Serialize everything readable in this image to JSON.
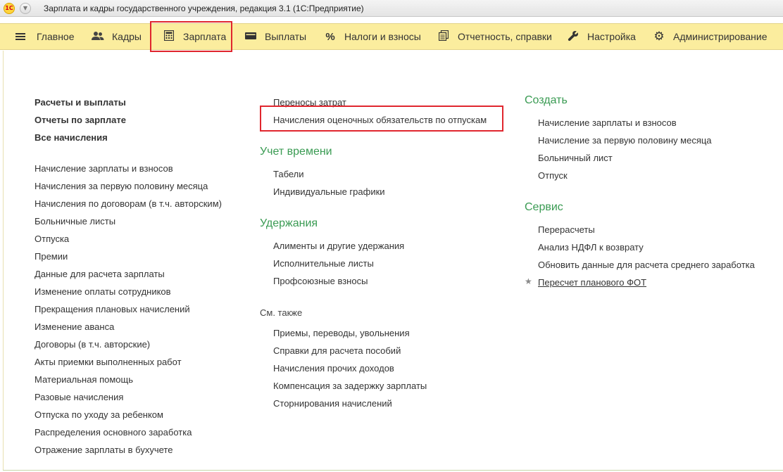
{
  "window": {
    "title": "Зарплата и кадры государственного учреждения, редакция 3.1  (1С:Предприятие)",
    "logo_text": "1С"
  },
  "sections": [
    {
      "label": "Главное",
      "icon": "hamburger-icon"
    },
    {
      "label": "Кадры",
      "icon": "people-icon"
    },
    {
      "label": "Зарплата",
      "icon": "calculator-icon",
      "active": true
    },
    {
      "label": "Выплаты",
      "icon": "wallet-icon"
    },
    {
      "label": "Налоги и взносы",
      "icon": "percent-icon"
    },
    {
      "label": "Отчетность, справки",
      "icon": "documents-icon"
    },
    {
      "label": "Настройка",
      "icon": "wrench-icon"
    },
    {
      "label": "Администрирование",
      "icon": "gear-icon"
    }
  ],
  "left_column": {
    "top_links": [
      "Расчеты и выплаты",
      "Отчеты по зарплате",
      "Все начисления"
    ],
    "links": [
      "Начисление зарплаты и взносов",
      "Начисления за первую половину месяца",
      "Начисления по договорам (в т.ч. авторским)",
      "Больничные листы",
      "Отпуска",
      "Премии",
      "Данные для расчета зарплаты",
      "Изменение оплаты сотрудников",
      "Прекращения плановых начислений",
      "Изменение аванса",
      "Договоры (в т.ч. авторские)",
      "Акты приемки выполненных работ",
      "Материальная помощь",
      "Разовые начисления",
      "Отпуска по уходу за ребенком",
      "Распределения основного заработка",
      "Отражение зарплаты в бухучете"
    ]
  },
  "middle_column": {
    "top_links": [
      "Переносы затрат",
      "Начисления оценочных обязательств по отпускам"
    ],
    "groups": [
      {
        "title": "Учет времени",
        "links": [
          "Табели",
          "Индивидуальные графики"
        ]
      },
      {
        "title": "Удержания",
        "links": [
          "Алименты и другие удержания",
          "Исполнительные листы",
          "Профсоюзные взносы"
        ]
      }
    ],
    "see_also": {
      "title": "См. также",
      "links": [
        "Приемы, переводы, увольнения",
        "Справки для расчета пособий",
        "Начисления прочих доходов",
        "Компенсация за задержку зарплаты",
        "Сторнирования начислений"
      ]
    }
  },
  "right_column": {
    "groups": [
      {
        "title": "Создать",
        "links": [
          "Начисление зарплаты и взносов",
          "Начисление за первую половину месяца",
          "Больничный лист",
          "Отпуск"
        ]
      },
      {
        "title": "Сервис",
        "links": [
          "Перерасчеты",
          "Анализ НДФЛ к возврату",
          "Обновить данные для расчета среднего заработка",
          "Пересчет планового ФОТ"
        ]
      }
    ]
  },
  "colors": {
    "section_panel": "#fbed9e",
    "group_header": "#3a9b53",
    "highlight": "#e0262e"
  }
}
